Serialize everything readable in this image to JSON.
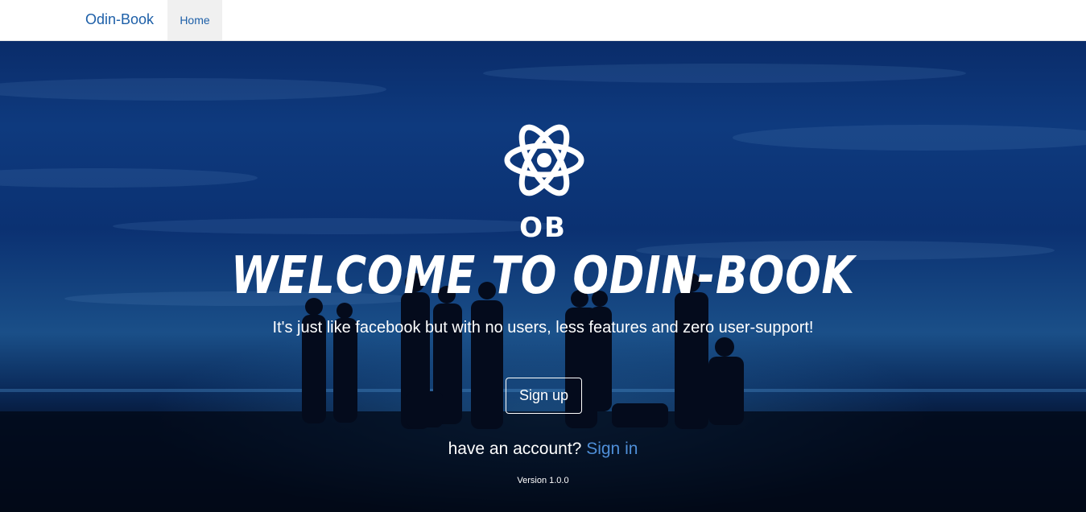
{
  "nav": {
    "brand": "Odin-Book",
    "home": "Home"
  },
  "hero": {
    "logo_text": "OB",
    "headline": "WELCOME TO ODIN-BOOK",
    "tagline": "It's just like facebook but with no users, less features and zero user-support!",
    "signup_label": "Sign up",
    "account_prompt": "have an account?",
    "signin_label": "Sign in",
    "version": "Version 1.0.0"
  },
  "icons": {
    "logo": "atom-icon"
  },
  "colors": {
    "brand_link": "#1d5fa8",
    "signin_link": "#4f8fd8",
    "hero_dark": "#06122c"
  }
}
